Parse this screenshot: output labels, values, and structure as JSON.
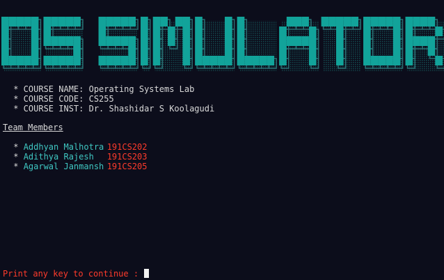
{
  "banner": {
    "text": "OS SIMULATOR",
    "colors": {
      "fill": "#12a39a",
      "shadow": "#2a6f73",
      "dots": "#1a7f7c"
    }
  },
  "course": {
    "lines": [
      " * COURSE NAME: Operating Systems Lab",
      " * COURSE CODE: CS255",
      " * COURSE INST: Dr. Shashidar S Koolagudi"
    ]
  },
  "team": {
    "heading": "Team Members",
    "bullet": " * ",
    "members": [
      {
        "name": "Addhyan Malhotra",
        "id": "191CS202"
      },
      {
        "name": "Adithya Rajesh",
        "id": "191CS203"
      },
      {
        "name": "Agarwal Janmansh",
        "id": "191CS205"
      }
    ]
  },
  "prompt": {
    "text": "Print any key to continue : "
  },
  "colors": {
    "background": "#0c0d1b",
    "text": "#d8d8d8",
    "member_name": "#3fc7c2",
    "member_id": "#ff3b2b",
    "prompt": "#ff3b2b",
    "cursor": "#f2f2f2"
  }
}
